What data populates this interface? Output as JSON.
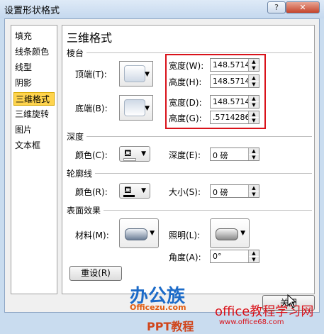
{
  "window": {
    "title": "设置形状格式",
    "help": "?",
    "close": "✕"
  },
  "nav": {
    "items": [
      "填充",
      "线条颜色",
      "线型",
      "阴影",
      "三维格式",
      "三维旋转",
      "图片",
      "文本框"
    ],
    "selected": "三维格式"
  },
  "panel": {
    "heading": "三维格式",
    "bevel": {
      "label": "棱台",
      "top_label": "顶端(T):",
      "bottom_label": "底端(B):",
      "top_width_label": "宽度(W):",
      "top_width": "148.5714",
      "top_height_label": "高度(H):",
      "top_height": "148.5714",
      "bottom_width_label": "宽度(D):",
      "bottom_width": "148.5714",
      "bottom_height_label": "高度(G):",
      "bottom_height": ".5714286'"
    },
    "depth": {
      "label": "深度",
      "color_label": "颜色(C):",
      "depth_label": "深度(E):",
      "depth_value": "0 磅"
    },
    "contour": {
      "label": "轮廓线",
      "color_label": "颜色(R):",
      "size_label": "大小(S):",
      "size_value": "0 磅"
    },
    "surface": {
      "label": "表面效果",
      "material_label": "材料(M):",
      "lighting_label": "照明(L):",
      "angle_label": "角度(A):",
      "angle_value": "0°"
    },
    "reset_label": "重设(R)"
  },
  "footer": {
    "close_label": "关闭"
  },
  "watermark": {
    "brand": "办公族",
    "domain": "Officezu.com",
    "ppt": "PPT教程",
    "site_cn": "office教程学习网",
    "site_url": "www.office68.com"
  },
  "colors": {
    "highlight": "#d9121a",
    "selected_nav": "#ffd44d",
    "watermark_blue": "#1c6bc8"
  }
}
